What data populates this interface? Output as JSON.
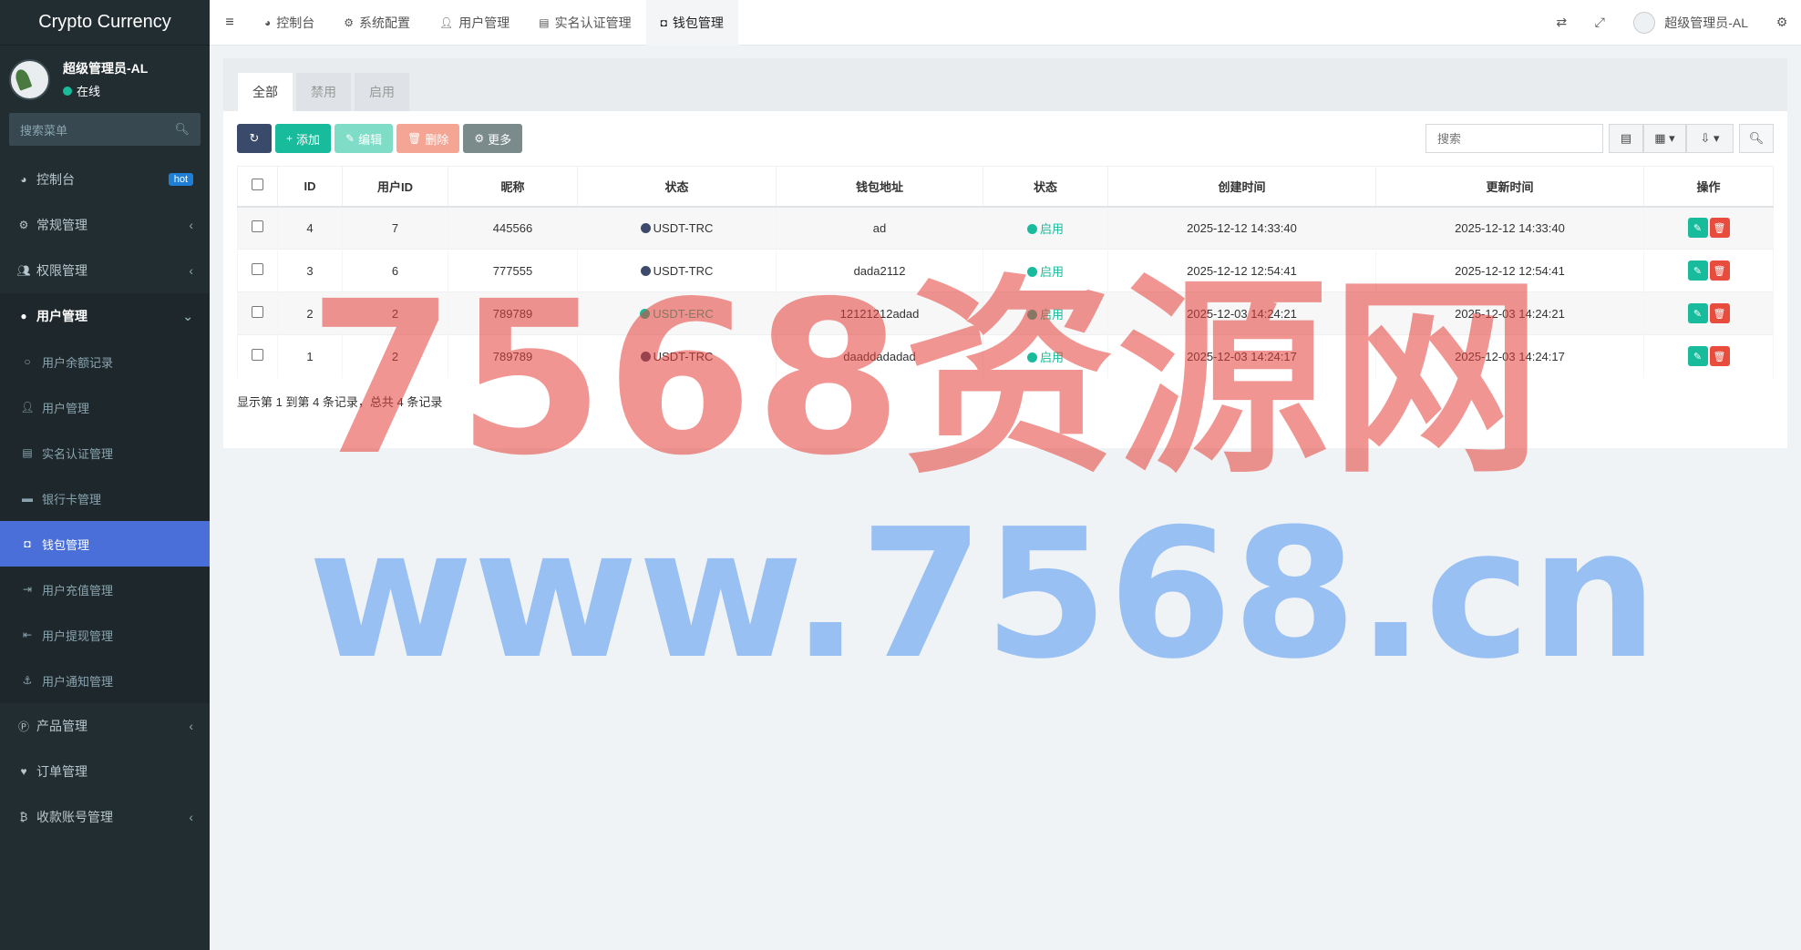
{
  "brand": "Crypto Currency",
  "user": {
    "name": "超级管理员-AL",
    "status": "在线"
  },
  "sidebar": {
    "search_placeholder": "搜索菜单",
    "items": [
      {
        "label": "控制台",
        "icon": "dashboard-icon",
        "badge": "hot"
      },
      {
        "label": "常规管理",
        "icon": "cogs-icon"
      },
      {
        "label": "权限管理",
        "icon": "group-icon"
      },
      {
        "label": "用户管理",
        "icon": "user-circle-icon"
      },
      {
        "label": "产品管理",
        "icon": "product-icon"
      },
      {
        "label": "订单管理",
        "icon": "heartbeat-icon"
      },
      {
        "label": "收款账号管理",
        "icon": "bitcoin-icon"
      }
    ],
    "sub_items": [
      {
        "label": "用户余额记录",
        "icon": "circle-icon"
      },
      {
        "label": "用户管理",
        "icon": "user-icon"
      },
      {
        "label": "实名认证管理",
        "icon": "id-card-icon"
      },
      {
        "label": "银行卡管理",
        "icon": "credit-card-icon"
      },
      {
        "label": "钱包管理",
        "icon": "money-icon"
      },
      {
        "label": "用户充值管理",
        "icon": "sign-in-icon"
      },
      {
        "label": "用户提现管理",
        "icon": "sign-out-icon"
      },
      {
        "label": "用户通知管理",
        "icon": "anchor-icon"
      }
    ]
  },
  "topbar": {
    "tabs": [
      {
        "label": "控制台",
        "icon": "dashboard-icon"
      },
      {
        "label": "系统配置",
        "icon": "cog-icon"
      },
      {
        "label": "用户管理",
        "icon": "user-icon"
      },
      {
        "label": "实名认证管理",
        "icon": "id-card-icon"
      },
      {
        "label": "钱包管理",
        "icon": "money-icon"
      }
    ],
    "user_name": "超级管理员-AL"
  },
  "content": {
    "filter_tabs": [
      "全部",
      "禁用",
      "启用"
    ],
    "buttons": {
      "add": "添加",
      "edit": "编辑",
      "delete": "删除",
      "more": "更多"
    },
    "search_placeholder": "搜索",
    "columns": [
      "ID",
      "用户ID",
      "昵称",
      "状态",
      "钱包地址",
      "状态",
      "创建时间",
      "更新时间",
      "操作"
    ],
    "rows": [
      {
        "id": "4",
        "user_id": "7",
        "nickname": "445566",
        "type": "USDT-TRC",
        "type_color": "#3d4a6b",
        "address": "ad",
        "status": "启用",
        "created": "2025-12-12 14:33:40",
        "updated": "2025-12-12 14:33:40"
      },
      {
        "id": "3",
        "user_id": "6",
        "nickname": "777555",
        "type": "USDT-TRC",
        "type_color": "#3d4a6b",
        "address": "dada2112",
        "status": "启用",
        "created": "2025-12-12 12:54:41",
        "updated": "2025-12-12 12:54:41"
      },
      {
        "id": "2",
        "user_id": "2",
        "nickname": "789789",
        "type": "USDT-ERC",
        "type_color": "#18bc9c",
        "address": "12121212adad",
        "status": "启用",
        "created": "2025-12-03 14:24:21",
        "updated": "2025-12-03 14:24:21"
      },
      {
        "id": "1",
        "user_id": "2",
        "nickname": "789789",
        "type": "USDT-TRC",
        "type_color": "#3d4a6b",
        "address": "daaddadadad",
        "status": "启用",
        "created": "2025-12-03 14:24:17",
        "updated": "2025-12-03 14:24:17"
      }
    ],
    "pager_info": "显示第 1 到第 4 条记录，总共 4 条记录"
  },
  "watermark": {
    "line1": "7568资源网",
    "line2": "www.7568.cn"
  },
  "colors": {
    "sidebar_bg": "#222d32",
    "accent": "#18bc9c",
    "active_menu": "#4a6fd8",
    "danger": "#e74c3c"
  }
}
